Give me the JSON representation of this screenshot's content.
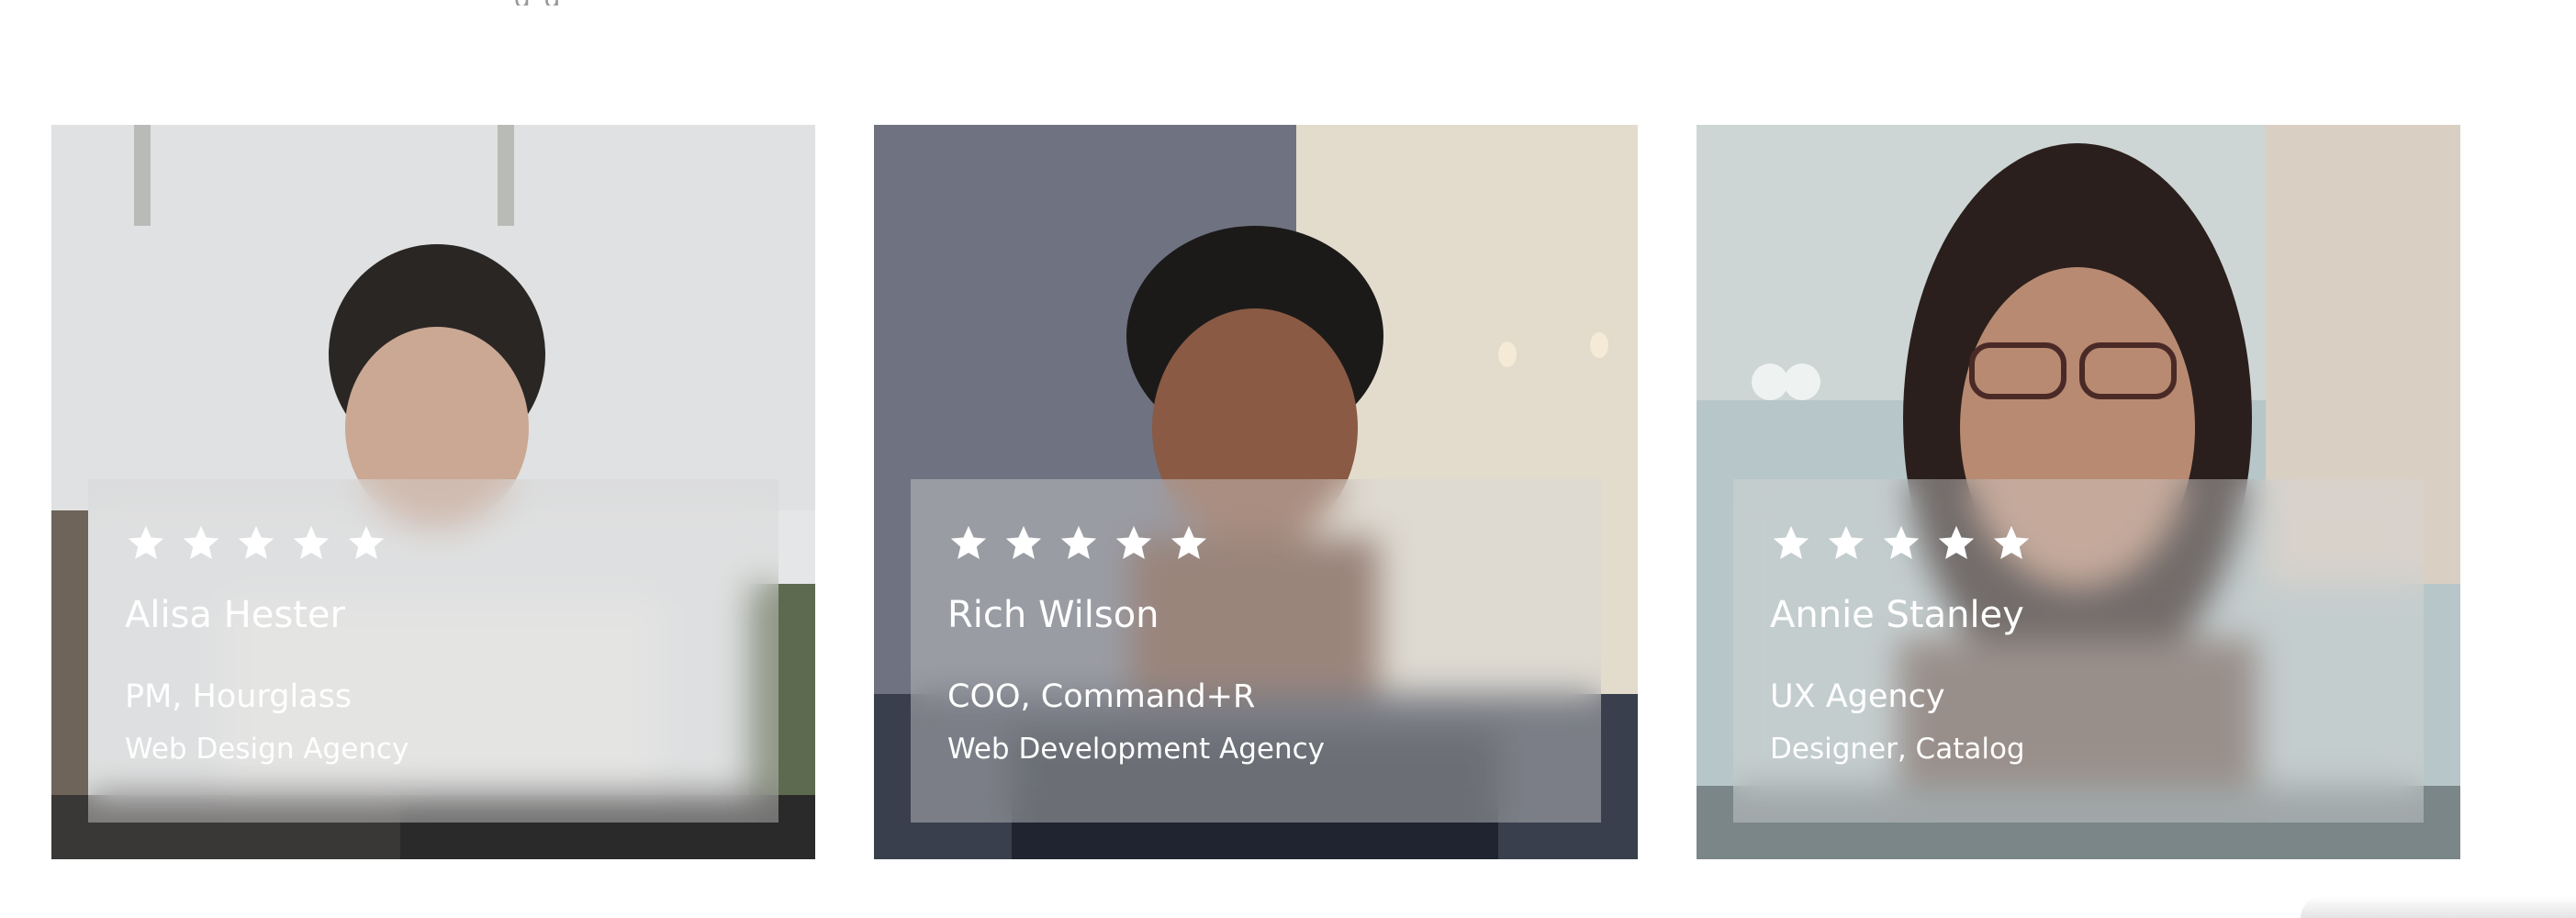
{
  "top_fragment": "g                                 g",
  "cards": [
    {
      "rating": 5,
      "name": "Alisa Hester",
      "role": "PM, Hourglass",
      "company": "Web Design Agency"
    },
    {
      "rating": 5,
      "name": "Rich Wilson",
      "role": "COO, Command+R",
      "company": "Web Development Agency"
    },
    {
      "rating": 5,
      "name": "Annie Stanley",
      "role": "UX Agency",
      "company": "Designer, Catalog"
    }
  ],
  "colors": {
    "text": "#ffffff",
    "star": "#ffffff",
    "overlay": "rgba(215,215,215,0.42)"
  },
  "icons": {
    "star": "star-icon"
  }
}
